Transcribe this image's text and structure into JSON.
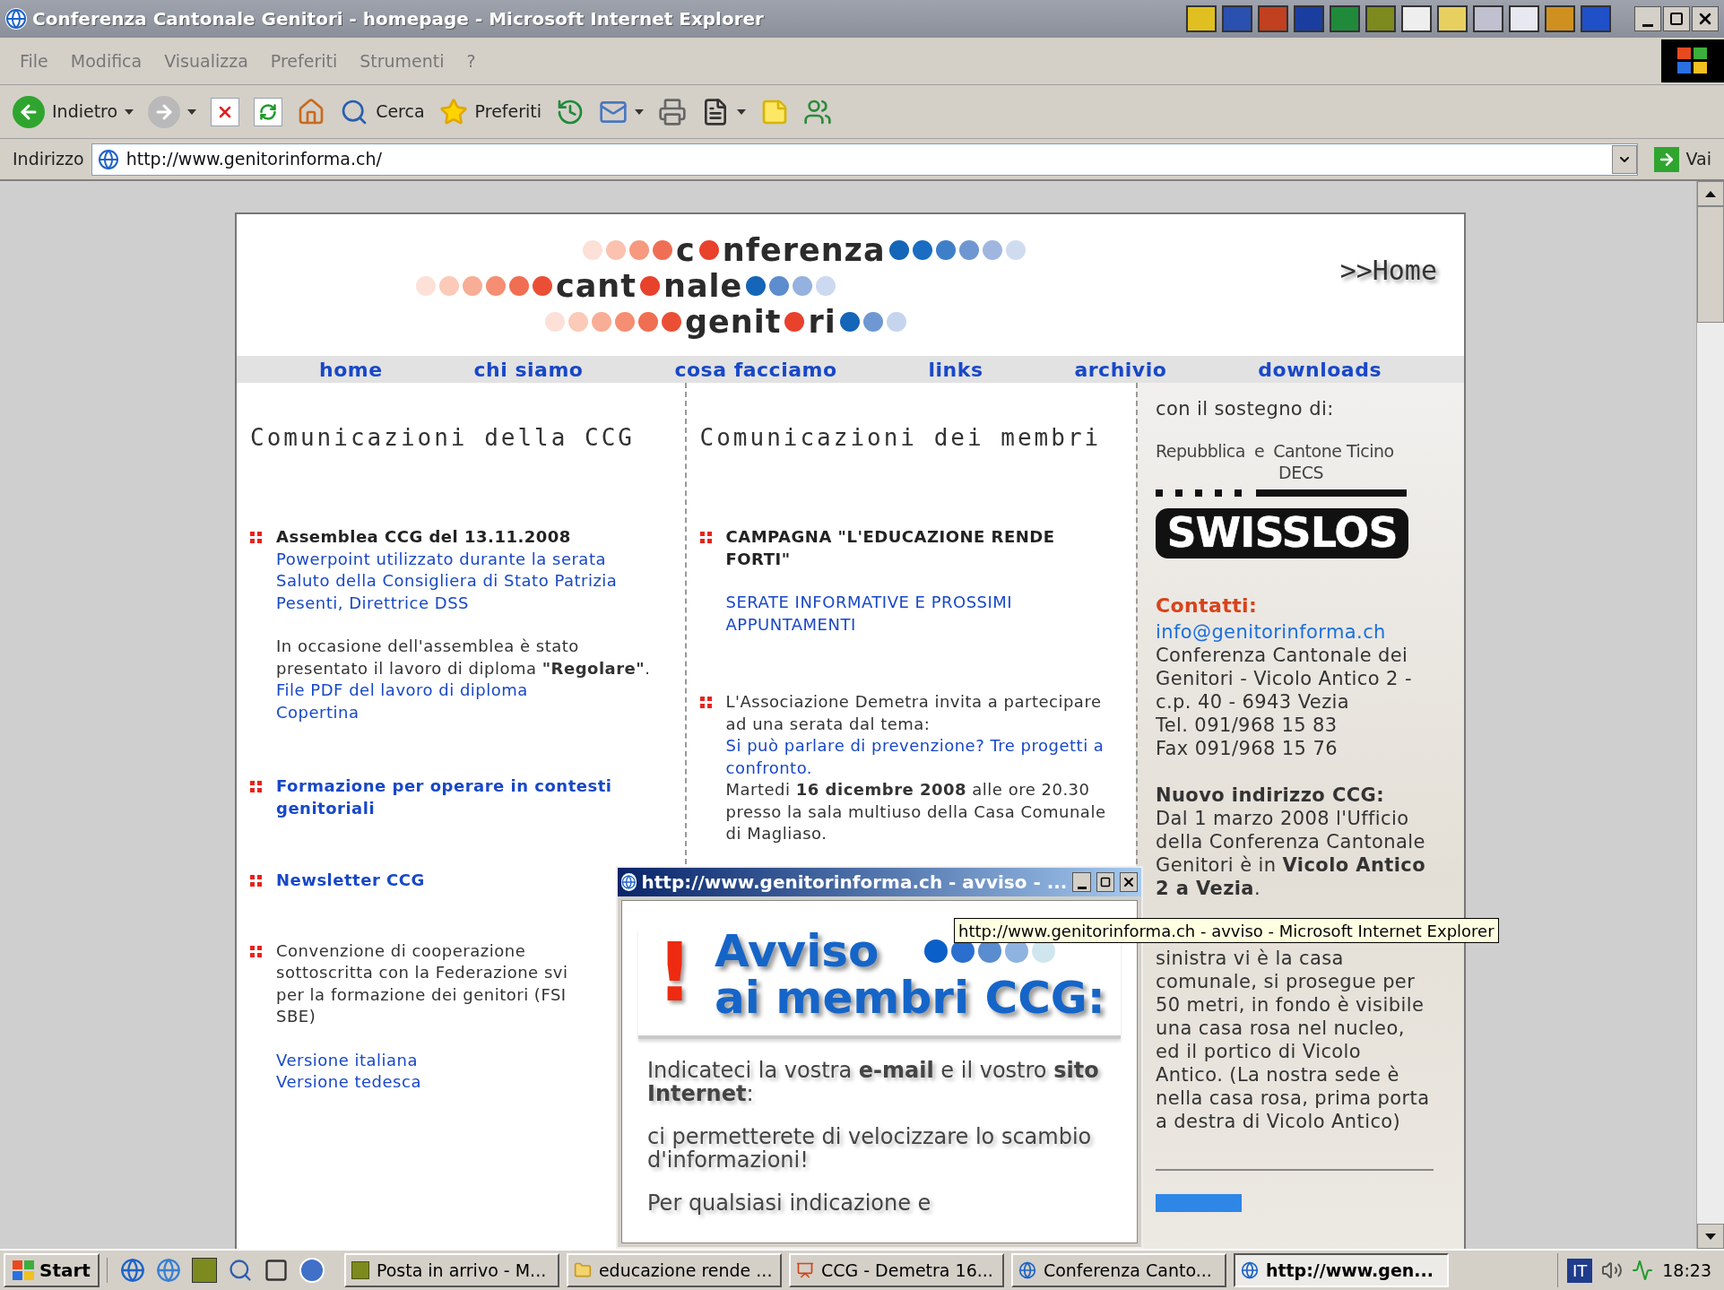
{
  "window": {
    "title": "Conferenza Cantonale Genitori - homepage - Microsoft Internet Explorer"
  },
  "menu": [
    "File",
    "Modifica",
    "Visualizza",
    "Preferiti",
    "Strumenti",
    "?"
  ],
  "toolbar": [
    {
      "kind": "back",
      "label": "Indietro",
      "dropdown": true
    },
    {
      "kind": "forward",
      "dropdown": true
    },
    {
      "kind": "stop",
      "dropdown": false
    },
    {
      "kind": "refresh",
      "dropdown": false
    },
    {
      "kind": "home",
      "dropdown": false
    },
    {
      "kind": "search",
      "label": "Cerca",
      "dropdown": false
    },
    {
      "kind": "favorites",
      "label": "Preferiti",
      "dropdown": false
    },
    {
      "kind": "history",
      "dropdown": false
    },
    {
      "kind": "mail",
      "dropdown": true
    },
    {
      "kind": "print",
      "dropdown": false
    },
    {
      "kind": "edit",
      "dropdown": true
    },
    {
      "kind": "note",
      "dropdown": false
    },
    {
      "kind": "messenger",
      "dropdown": false
    }
  ],
  "address": {
    "label": "Indirizzo",
    "value": "http://www.genitorinforma.ch/",
    "go": "Vai"
  },
  "logo": [
    {
      "before": "c",
      "after": "nferenza"
    },
    {
      "before": "cant",
      "after": "nale"
    },
    {
      "before": "genit",
      "after": "ri"
    }
  ],
  "home_link": ">>Home",
  "nav": [
    "home",
    "chi siamo",
    "cosa facciamo",
    "links",
    "archivio",
    "downloads"
  ],
  "columns": [
    {
      "heading": "Comunicazioni della CCG",
      "items": [
        {
          "groups": [
            [
              {
                "kind": "title",
                "text": "Assemblea CCG del 13.11.2008"
              },
              {
                "kind": "link",
                "text": "Powerpoint utilizzato durante la serata"
              },
              {
                "kind": "link",
                "text": "Saluto della Consigliera di Stato Patrizia Pesenti, Direttrice DSS"
              }
            ],
            [
              {
                "kind": "text",
                "text": "In occasione dell'assemblea è stato presentato il lavoro di diploma **\"Regolare\"**."
              },
              {
                "kind": "link",
                "text": "File PDF del lavoro di diploma"
              },
              {
                "kind": "link",
                "text": "Copertina"
              }
            ]
          ]
        },
        {
          "groups": [
            [
              {
                "kind": "link_bold",
                "text": "Formazione per operare in contesti genitoriali"
              }
            ]
          ]
        },
        {
          "groups": [
            [
              {
                "kind": "link_bold",
                "text": "Newsletter CCG"
              }
            ]
          ]
        },
        {
          "groups": [
            [
              {
                "kind": "text",
                "text": "Convenzione di cooperazione sottoscritta con la Federazione svi per la formazione dei genitori (FSI SBE)"
              }
            ],
            [
              {
                "kind": "link",
                "text": "Versione italiana"
              },
              {
                "kind": "link",
                "text": "Versione tedesca"
              }
            ]
          ]
        }
      ]
    },
    {
      "heading": "Comunicazioni dei membri",
      "items": [
        {
          "groups": [
            [
              {
                "kind": "title",
                "text": "CAMPAGNA \"L'EDUCAZIONE RENDE FORTI\""
              }
            ],
            [
              {
                "kind": "link",
                "text": "SERATE INFORMATIVE E PROSSIMI APPUNTAMENTI"
              }
            ]
          ]
        },
        {
          "groups": [
            [
              {
                "kind": "text",
                "text": "L'Associazione Demetra invita a partecipare ad una serata dal tema:"
              },
              {
                "kind": "link",
                "text": "Si può parlare di prevenzione? Tre progetti a confronto."
              },
              {
                "kind": "text",
                "text": "Martedi **16 dicembre 2008** alle ore 20.30 presso la sala multiuso della Casa Comunale di Magliaso."
              }
            ]
          ]
        }
      ]
    }
  ],
  "sidebar": {
    "support_label": "con il sostegno di:",
    "sponsor": {
      "left": "Repubblica",
      "mid": "e",
      "right": "Cantone Ticino",
      "sub": "DECS"
    },
    "lottery": "SWISSLOS",
    "contacts_heading": "Contatti:",
    "email": "info@genitorinforma.ch",
    "contact_lines": [
      "Conferenza Cantonale dei Genitori - Vicolo Antico 2 - c.p. 40 - 6943 Vezia",
      "Tel. 091/968 15 83",
      "Fax 091/968 15 76"
    ],
    "address_heading": "Nuovo indirizzo CCG:",
    "address_text": "Dal 1 marzo 2008 l'Ufficio della Conferenza Cantonale Genitori è in **Vicolo Antico 2 a Vezia**.",
    "address_more": "sinistra vi è la casa comunale, si prosegue per 50 metri, in fondo è visibile una casa rosa nel nucleo, ed il portico di Vicolo Antico. (La nostra sede è nella casa rosa, prima porta a destra di Vicolo Antico)"
  },
  "popup": {
    "title": "http://www.genitorinforma.ch - avviso - ...",
    "mark": "!",
    "heading": [
      "Avviso",
      "ai membri CCG:"
    ],
    "paragraphs": [
      "Indicateci la vostra **e-mail** e il vostro **sito Internet**:",
      "ci permetterete di velocizzare lo scambio d'informazioni!",
      "Per qualsiasi indicazione e"
    ]
  },
  "tooltip": "http://www.genitorinforma.ch - avviso - Microsoft Internet Explorer",
  "taskbar": {
    "start": "Start",
    "tasks": [
      {
        "kind": "mail",
        "label": "Posta in arrivo - M...",
        "selected": false
      },
      {
        "kind": "folder",
        "label": "educazione rende ...",
        "selected": false
      },
      {
        "kind": "slides",
        "label": "CCG - Demetra 16...",
        "selected": false
      },
      {
        "kind": "browser",
        "label": "Conferenza Canto...",
        "selected": false
      },
      {
        "kind": "browser",
        "label": "http://www.gen...",
        "selected": true
      }
    ],
    "lang": "IT",
    "clock": "18:23"
  }
}
